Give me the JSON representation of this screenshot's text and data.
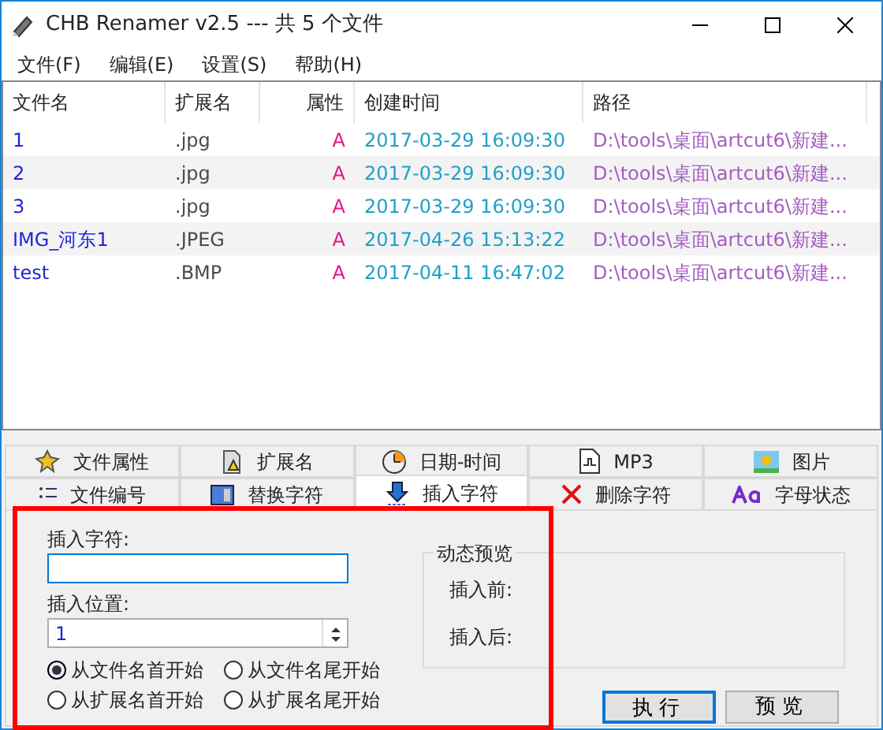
{
  "window": {
    "title": "CHB Renamer v2.5 --- 共 5 个文件"
  },
  "menu": [
    "文件(F)",
    "编辑(E)",
    "设置(S)",
    "帮助(H)"
  ],
  "table": {
    "columns": [
      "文件名",
      "扩展名",
      "属性",
      "创建时间",
      "路径"
    ],
    "rows": [
      {
        "name": "1",
        "ext": ".jpg",
        "attr": "A",
        "created": "2017-03-29 16:09:30",
        "path": "D:\\tools\\桌面\\artcut6\\新建..."
      },
      {
        "name": "2",
        "ext": ".jpg",
        "attr": "A",
        "created": "2017-03-29 16:09:30",
        "path": "D:\\tools\\桌面\\artcut6\\新建..."
      },
      {
        "name": "3",
        "ext": ".jpg",
        "attr": "A",
        "created": "2017-03-29 16:09:30",
        "path": "D:\\tools\\桌面\\artcut6\\新建..."
      },
      {
        "name": "IMG_河东1",
        "ext": ".JPEG",
        "attr": "A",
        "created": "2017-04-26 15:13:22",
        "path": "D:\\tools\\桌面\\artcut6\\新建..."
      },
      {
        "name": "test",
        "ext": ".BMP",
        "attr": "A",
        "created": "2017-04-11 16:47:02",
        "path": "D:\\tools\\桌面\\artcut6\\新建..."
      }
    ]
  },
  "tab_rows": [
    [
      {
        "label": "文件属性",
        "selected": false
      },
      {
        "label": "扩展名",
        "selected": false
      },
      {
        "label": "日期-时间",
        "selected": false
      },
      {
        "label": "MP3",
        "selected": false
      },
      {
        "label": "图片",
        "selected": false
      }
    ],
    [
      {
        "label": "文件编号",
        "selected": false
      },
      {
        "label": "替换字符",
        "selected": false
      },
      {
        "label": "插入字符",
        "selected": true
      },
      {
        "label": "删除字符",
        "selected": false
      },
      {
        "label": "字母状态",
        "selected": false
      }
    ]
  ],
  "panel": {
    "insert_text": {
      "label": "插入字符:"
    },
    "position": {
      "label": "插入位置:",
      "value": "1"
    },
    "radios": [
      {
        "label": "从文件名首开始",
        "selected": true
      },
      {
        "label": "从文件名尾开始",
        "selected": false
      },
      {
        "label": "从扩展名首开始",
        "selected": false
      },
      {
        "label": "从扩展名尾开始",
        "selected": false
      }
    ],
    "preview": {
      "title": "动态预览",
      "before": "插入前:",
      "after": "插入后:"
    },
    "buttons": [
      {
        "label": "执行",
        "default": true
      },
      {
        "label": "预览",
        "default": false
      }
    ]
  }
}
